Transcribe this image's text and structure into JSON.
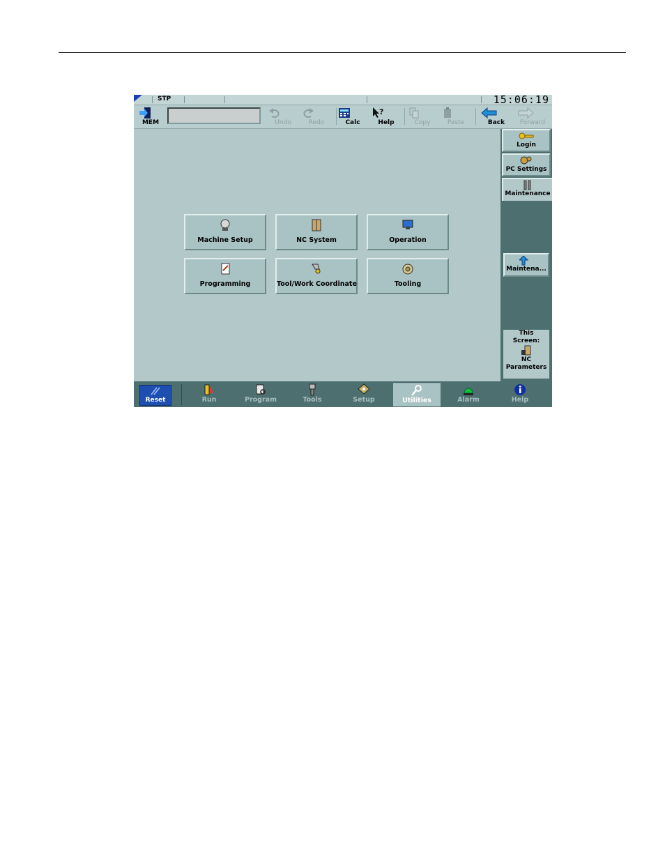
{
  "status": {
    "mode": "STP",
    "clock": "15:06:19"
  },
  "toolbar": {
    "mem_label": "MEM",
    "undo": "Undo",
    "redo": "Redo",
    "calc": "Calc",
    "help": "Help",
    "copy": "Copy",
    "paste": "Paste",
    "back": "Back",
    "forward": "Forward"
  },
  "main": {
    "buttons": [
      {
        "label": "Machine Setup",
        "icon": "machine-icon"
      },
      {
        "label": "NC System",
        "icon": "cabinet-icon"
      },
      {
        "label": "Operation",
        "icon": "monitor-icon"
      },
      {
        "label": "Programming",
        "icon": "document-icon"
      },
      {
        "label": "Tool/Work Coordinate",
        "icon": "probe-icon"
      },
      {
        "label": "Tooling",
        "icon": "tool-disc-icon"
      }
    ]
  },
  "sidebar": {
    "tabs": [
      {
        "label": "Login",
        "icon": "key-icon"
      },
      {
        "label": "PC Settings",
        "icon": "gears-icon"
      },
      {
        "label": "Maintenance",
        "icon": "wrench-icon"
      }
    ],
    "up_button": "Maintena...",
    "this_screen": {
      "line1": "This",
      "line2": "Screen:",
      "line3": "NC",
      "line4": "Parameters"
    }
  },
  "bottom": {
    "reset": "Reset",
    "nav": [
      "Run",
      "Program",
      "Tools",
      "Setup",
      "Utilities",
      "Alarm",
      "Help"
    ]
  },
  "colors": {
    "accent": "#1e4fb0",
    "panel": "#4d6f70",
    "background": "#b2c8c9"
  }
}
